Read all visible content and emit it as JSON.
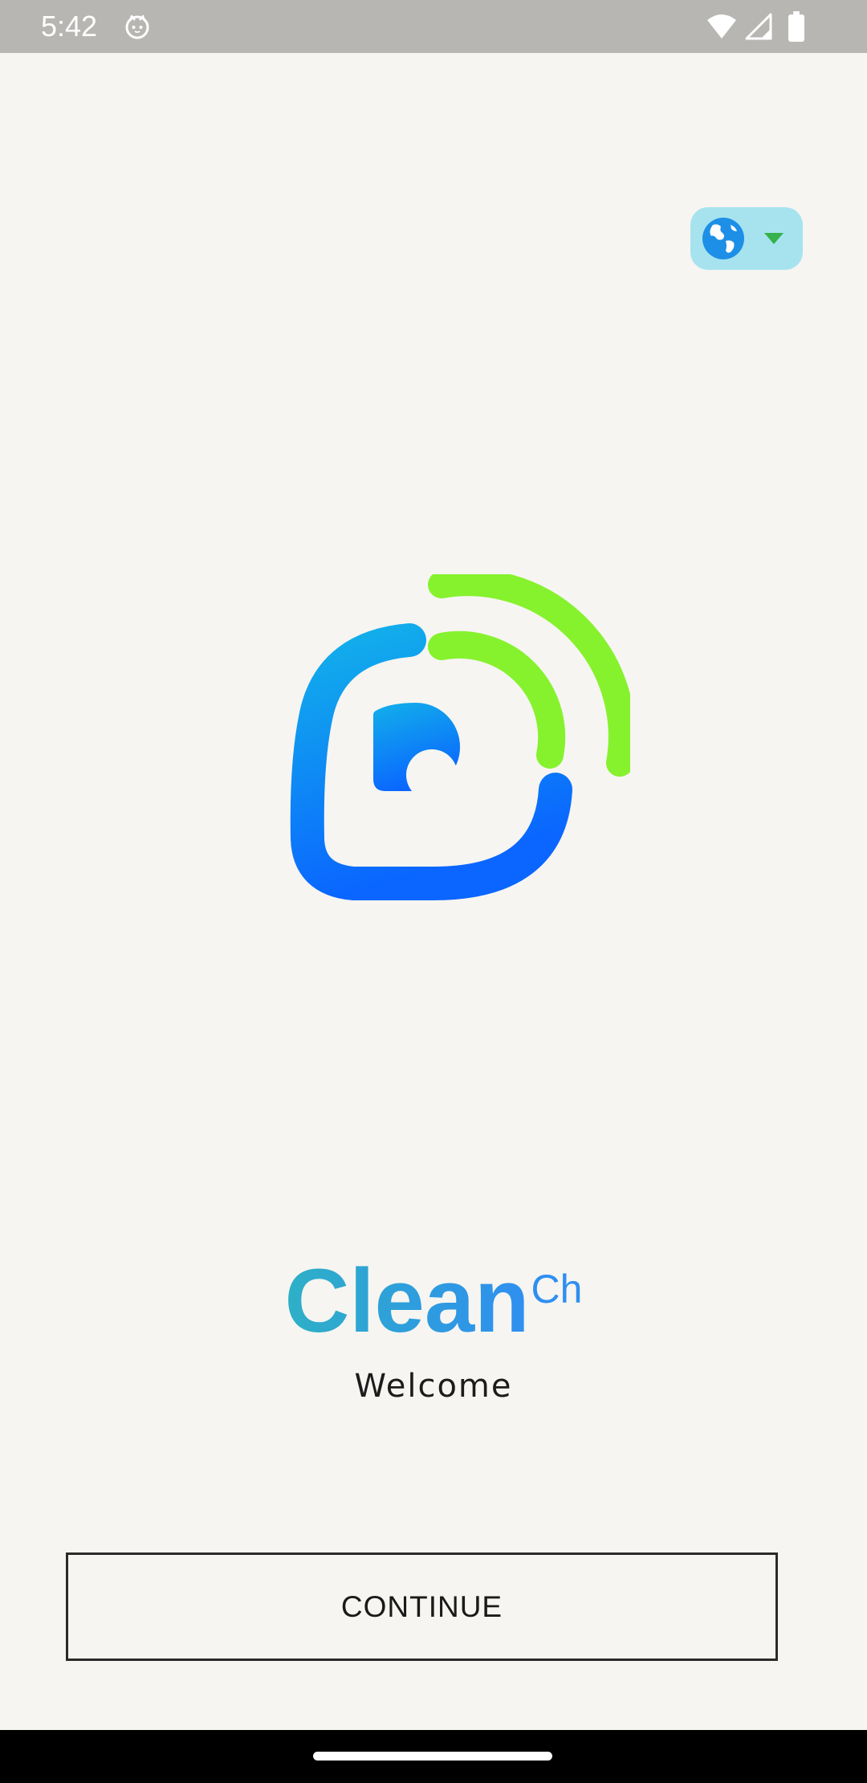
{
  "status_bar": {
    "time": "5:42",
    "icons": [
      "cat-icon",
      "wifi-icon",
      "signal-icon",
      "battery-icon"
    ]
  },
  "language_selector": {
    "icon": "globe-icon",
    "dropdown_icon": "caret-down-icon"
  },
  "logo": {
    "icon": "app-logo-icon",
    "colors": {
      "blue_top": "#12b0ea",
      "blue_bottom": "#0a66ff",
      "green": "#86f22e"
    }
  },
  "brand": {
    "name_main": "Clean",
    "name_sub": "Ch",
    "color": "#2f8ff0"
  },
  "welcome": "Welcome",
  "continue_label": "CONTINUE",
  "colors": {
    "background": "#f6f5f1",
    "status_bar": "#b7b6b2",
    "language_pill": "#a6e3ef"
  }
}
